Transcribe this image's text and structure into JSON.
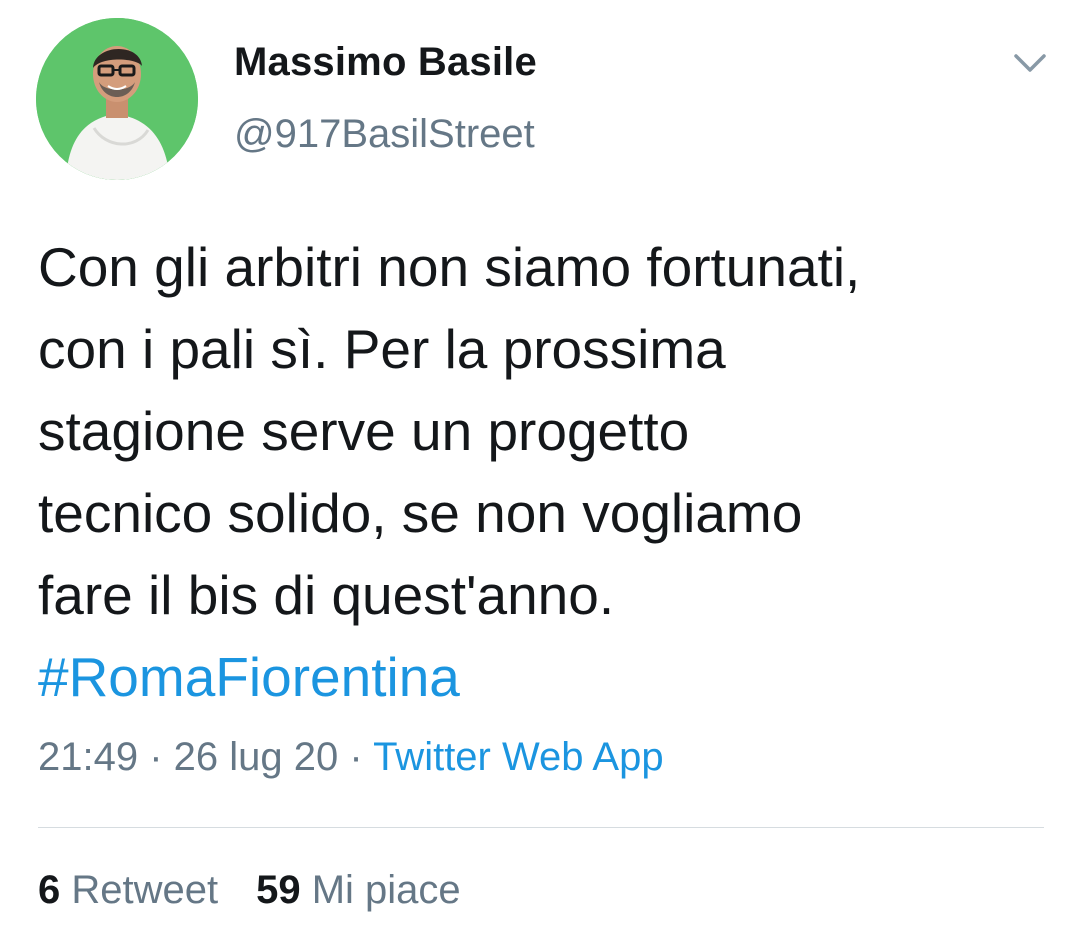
{
  "author": {
    "display_name": "Massimo Basile",
    "handle": "@917BasilStreet"
  },
  "tweet": {
    "text_lines": [
      "Con gli arbitri non siamo fortunati,",
      "con i pali sì. Per la prossima",
      "stagione serve un progetto",
      "tecnico solido, se non vogliamo",
      "fare il bis di quest'anno."
    ],
    "hashtag": "#RomaFiorentina"
  },
  "meta": {
    "time": "21:49",
    "separator": " · ",
    "date": "26 lug 20",
    "source": "Twitter Web App"
  },
  "stats": {
    "retweets_count": "6",
    "retweets_label": " Retweet",
    "likes_count": "59",
    "likes_label": " Mi piace"
  },
  "colors": {
    "accent": "#1b95e0",
    "secondary_text": "#657786",
    "avatar_bg": "#5ec56b"
  },
  "icons": {
    "menu": "chevron-down-icon"
  }
}
